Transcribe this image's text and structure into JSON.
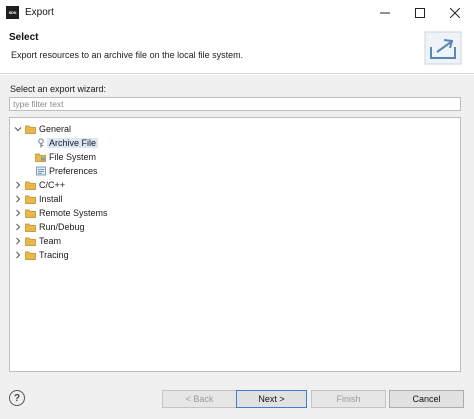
{
  "window": {
    "app_icon_text": "SDK",
    "title": "Export",
    "controls": [
      "minimize-icon",
      "maximize-icon",
      "close-icon"
    ]
  },
  "header": {
    "title": "Select",
    "description": "Export resources to an archive file on the local file system.",
    "image_icon": "export-banner-icon"
  },
  "main": {
    "wizard_label": "Select an export wizard:",
    "filter_placeholder": "type filter text",
    "filter_value": ""
  },
  "tree": {
    "items": [
      {
        "label": "General",
        "icon": "folder-icon",
        "expanded": true,
        "level": 0,
        "children": [
          {
            "label": "Archive File",
            "icon": "archive-file-icon",
            "selected": true
          },
          {
            "label": "File System",
            "icon": "file-system-icon"
          },
          {
            "label": "Preferences",
            "icon": "preferences-icon"
          }
        ]
      },
      {
        "label": "C/C++",
        "icon": "folder-icon",
        "expanded": false
      },
      {
        "label": "Install",
        "icon": "folder-icon",
        "expanded": false
      },
      {
        "label": "Remote Systems",
        "icon": "folder-icon",
        "expanded": false
      },
      {
        "label": "Run/Debug",
        "icon": "folder-icon",
        "expanded": false
      },
      {
        "label": "Team",
        "icon": "folder-icon",
        "expanded": false
      },
      {
        "label": "Tracing",
        "icon": "folder-icon",
        "expanded": false
      }
    ]
  },
  "buttons": {
    "help_icon": "help-icon",
    "help_glyph": "?",
    "back": "< Back",
    "next": "Next >",
    "finish": "Finish",
    "cancel": "Cancel",
    "back_enabled": false,
    "finish_enabled": false
  },
  "colors": {
    "folder": "#e8b84a",
    "selection": "#dbe7f5",
    "default_button_border": "#3c7fd4",
    "dialog_background": "#f0f0f0"
  }
}
